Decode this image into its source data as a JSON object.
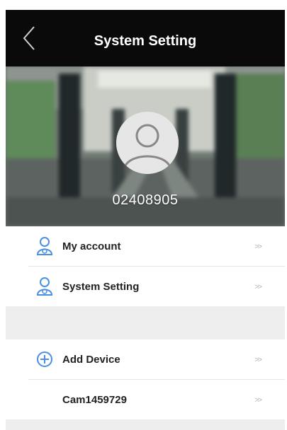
{
  "header": {
    "title": "System Setting"
  },
  "profile": {
    "user_id": "02408905"
  },
  "menu": {
    "account": {
      "label": "My account",
      "chevron": ">>"
    },
    "system_setting": {
      "label": "System Setting",
      "chevron": ">>"
    }
  },
  "devices": {
    "add": {
      "label": "Add Device",
      "chevron": ">>"
    },
    "items": [
      {
        "name": "Cam1459729",
        "chevron": ">>"
      }
    ]
  },
  "colors": {
    "header_bg": "#0a0a0a",
    "icon_blue": "#4a90e2",
    "section_gap": "#eeeeee"
  }
}
